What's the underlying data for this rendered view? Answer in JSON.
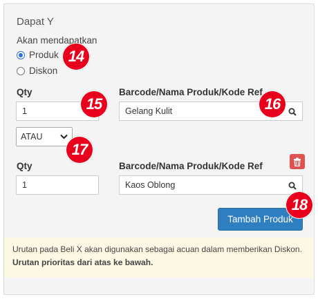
{
  "section": {
    "title": "Dapat Y",
    "subtitle": "Akan mendapatkan",
    "options": [
      "Produk",
      "Diskon"
    ],
    "selected_option": "Produk"
  },
  "rows": [
    {
      "qty_label": "Qty",
      "product_label": "Barcode/Nama Produk/Kode Ref",
      "qty_value": "1",
      "product_value": "Gelang Kulit"
    },
    {
      "qty_label": "Qty",
      "product_label": "Barcode/Nama Produk/Kode Ref",
      "qty_value": "1",
      "product_value": "Kaos Oblong"
    }
  ],
  "connector": {
    "selected": "ATAU"
  },
  "add_button_label": "Tambah Produk",
  "note": {
    "line1": "Urutan pada Beli X akan digunakan sebagai acuan dalam memberikan Diskon.",
    "line2": "Urutan prioritas dari atas ke bawah."
  },
  "badges": [
    "14",
    "15",
    "16",
    "17",
    "18"
  ],
  "colors": {
    "badge": "#e8001c",
    "primary": "#2f7ec0",
    "danger": "#e05252",
    "note_bg": "#fcf8e3"
  },
  "icons": [
    "search-icon",
    "trash-icon",
    "chevron-down-icon"
  ]
}
